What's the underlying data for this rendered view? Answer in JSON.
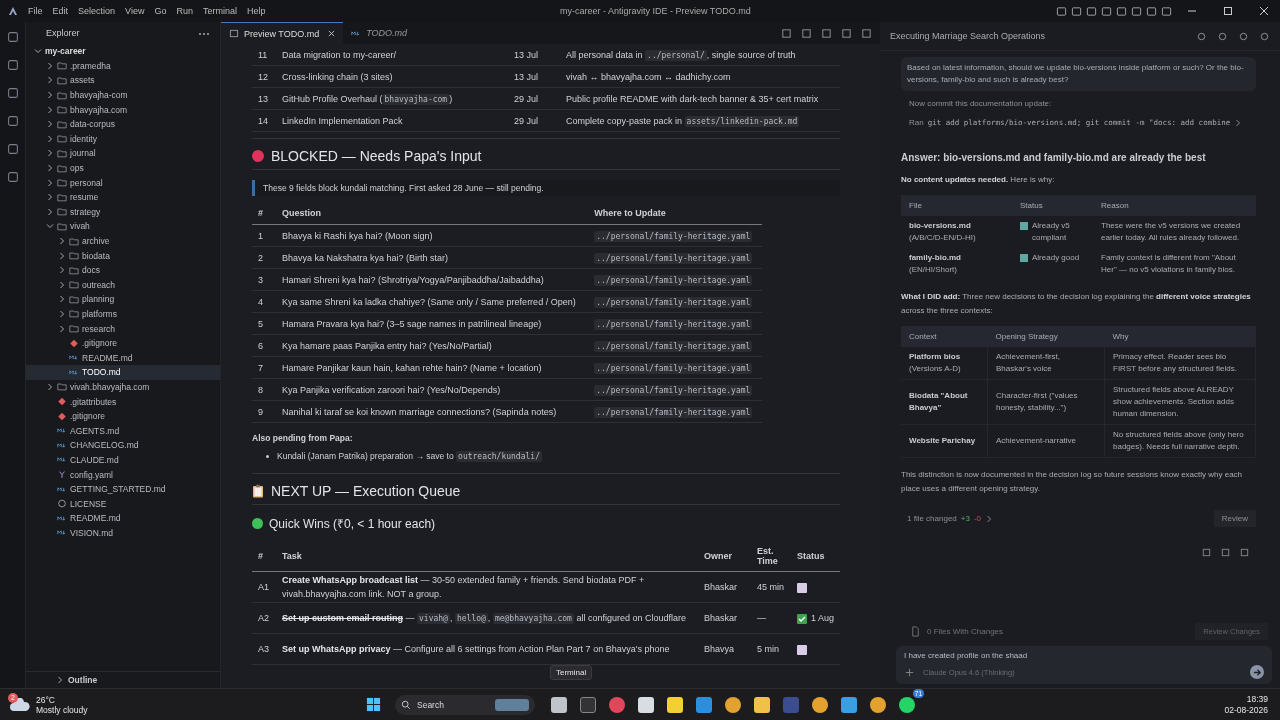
{
  "titlebar": {
    "menus": [
      "File",
      "Edit",
      "Selection",
      "View",
      "Go",
      "Run",
      "Terminal",
      "Help"
    ],
    "title": "my-career - Antigravity IDE - Preview TODO.md"
  },
  "sidebar": {
    "title": "Explorer",
    "outline": "Outline",
    "tree": [
      {
        "label": "my-career",
        "kind": "folder",
        "expanded": true,
        "selected": false,
        "children": [
          {
            "label": ".pramedha",
            "kind": "folder",
            "expanded": false,
            "selected": false
          },
          {
            "label": "assets",
            "kind": "folder",
            "expanded": false,
            "selected": false
          },
          {
            "label": "bhavyajha-com",
            "kind": "folder",
            "expanded": false,
            "selected": false
          },
          {
            "label": "bhavyajha.com",
            "kind": "folder",
            "expanded": false,
            "selected": false
          },
          {
            "label": "data-corpus",
            "kind": "folder",
            "expanded": false,
            "selected": false
          },
          {
            "label": "identity",
            "kind": "folder",
            "expanded": false,
            "selected": false
          },
          {
            "label": "journal",
            "kind": "folder",
            "expanded": false,
            "selected": false
          },
          {
            "label": "ops",
            "kind": "folder",
            "expanded": false,
            "selected": false
          },
          {
            "label": "personal",
            "kind": "folder",
            "expanded": false,
            "selected": false
          },
          {
            "label": "resume",
            "kind": "folder",
            "expanded": false,
            "selected": false
          },
          {
            "label": "strategy",
            "kind": "folder",
            "expanded": false,
            "selected": false
          },
          {
            "label": "vivah",
            "kind": "folder",
            "expanded": true,
            "selected": false,
            "children": [
              {
                "label": "archive",
                "kind": "folder",
                "expanded": false,
                "selected": false
              },
              {
                "label": "biodata",
                "kind": "folder",
                "expanded": false,
                "selected": false
              },
              {
                "label": "docs",
                "kind": "folder",
                "expanded": false,
                "selected": false
              },
              {
                "label": "outreach",
                "kind": "folder",
                "expanded": false,
                "selected": false
              },
              {
                "label": "planning",
                "kind": "folder",
                "expanded": false,
                "selected": false
              },
              {
                "label": "platforms",
                "kind": "folder",
                "expanded": false,
                "selected": false
              },
              {
                "label": "research",
                "kind": "folder",
                "expanded": false,
                "selected": false
              },
              {
                "label": ".gitignore",
                "kind": "git",
                "selected": false
              },
              {
                "label": "README.md",
                "kind": "markdown",
                "selected": false
              },
              {
                "label": "TODO.md",
                "kind": "markdown",
                "selected": true
              }
            ]
          },
          {
            "label": "vivah.bhavyajha.com",
            "kind": "folder",
            "expanded": false,
            "selected": false
          },
          {
            "label": ".gitattributes",
            "kind": "git",
            "selected": false
          },
          {
            "label": ".gitignore",
            "kind": "git",
            "selected": false
          },
          {
            "label": "AGENTS.md",
            "kind": "markdown",
            "selected": false
          },
          {
            "label": "CHANGELOG.md",
            "kind": "markdown",
            "selected": false
          },
          {
            "label": "CLAUDE.md",
            "kind": "markdown",
            "selected": false
          },
          {
            "label": "config.yaml",
            "kind": "yaml",
            "selected": false
          },
          {
            "label": "GETTING_STARTED.md",
            "kind": "markdown",
            "selected": false
          },
          {
            "label": "LICENSE",
            "kind": "license",
            "selected": false
          },
          {
            "label": "README.md",
            "kind": "markdown",
            "selected": false
          },
          {
            "label": "VISION.md",
            "kind": "markdown",
            "selected": false
          }
        ]
      }
    ]
  },
  "tabs": [
    {
      "label": "Preview TODO.md",
      "kind": "preview",
      "selected": true
    },
    {
      "label": "TODO.md",
      "kind": "markdown",
      "selected": false
    }
  ],
  "editor": {
    "done_rows": [
      {
        "num": "11",
        "title": [
          {
            "kind": "text",
            "text": "Data migration to my-career/"
          }
        ],
        "date": "13 Jul",
        "note": [
          {
            "kind": "text",
            "text": "All personal data in "
          },
          {
            "kind": "code",
            "text": "../personal/"
          },
          {
            "kind": "text",
            "text": ", single source of truth"
          }
        ]
      },
      {
        "num": "12",
        "title": [
          {
            "kind": "text",
            "text": "Cross-linking chain (3 sites)"
          }
        ],
        "date": "13 Jul",
        "note": [
          {
            "kind": "text",
            "text": "vivah ↔ bhavyajha.com ↔ dadhichy.com"
          }
        ]
      },
      {
        "num": "13",
        "title": [
          {
            "kind": "text",
            "text": "GitHub Profile Overhaul ("
          },
          {
            "kind": "code",
            "text": "bhavyajha-com"
          },
          {
            "kind": "text",
            "text": ")"
          }
        ],
        "date": "29 Jul",
        "note": [
          {
            "kind": "text",
            "text": "Public profile README with dark-tech banner & 35+ cert matrix"
          }
        ]
      },
      {
        "num": "14",
        "title": [
          {
            "kind": "text",
            "text": "LinkedIn Implementation Pack"
          }
        ],
        "date": "29 Jul",
        "note": [
          {
            "kind": "text",
            "text": "Complete copy-paste pack in "
          },
          {
            "kind": "code",
            "text": "assets/linkedin-pack.md"
          }
        ]
      }
    ],
    "blocked": {
      "heading": "BLOCKED — Needs Papa's Input",
      "note": "These 9 fields block kundali matching. First asked 28 June — still pending.",
      "columns": [
        "#",
        "Question",
        "Where to Update"
      ],
      "rows": [
        {
          "num": "1",
          "question": "Bhavya ki Rashi kya hai? (Moon sign)",
          "where": "../personal/family-heritage.yaml"
        },
        {
          "num": "2",
          "question": "Bhavya ka Nakshatra kya hai? (Birth star)",
          "where": "../personal/family-heritage.yaml"
        },
        {
          "num": "3",
          "question": "Hamari Shreni kya hai? (Shrotriya/Yogya/Panjibaddha/Jaibaddha)",
          "where": "../personal/family-heritage.yaml"
        },
        {
          "num": "4",
          "question": "Kya same Shreni ka ladka chahiye? (Same only / Same preferred / Open)",
          "where": "../personal/family-heritage.yaml"
        },
        {
          "num": "5",
          "question": "Hamara Pravara kya hai? (3–5 sage names in patrilineal lineage)",
          "where": "../personal/family-heritage.yaml"
        },
        {
          "num": "6",
          "question": "Kya hamare paas Panjika entry hai? (Yes/No/Partial)",
          "where": "../personal/family-heritage.yaml"
        },
        {
          "num": "7",
          "question": "Hamare Panjikar kaun hain, kahan rehte hain? (Name + location)",
          "where": "../personal/family-heritage.yaml"
        },
        {
          "num": "8",
          "question": "Kya Panjika verification zaroori hai? (Yes/No/Depends)",
          "where": "../personal/family-heritage.yaml"
        },
        {
          "num": "9",
          "question": "Nanihal ki taraf se koi known marriage connections? (Sapinda notes)",
          "where": "../personal/family-heritage.yaml"
        }
      ],
      "also_title": "Also pending from Papa:",
      "also_items": [
        {
          "text": "Kundali (Janam Patrika) preparation → save to ",
          "code": "outreach/kundali/"
        }
      ]
    },
    "next_heading": "NEXT UP — Execution Queue",
    "quick_heading": "Quick Wins (₹0, < 1 hour each)",
    "tasks": {
      "columns": [
        "#",
        "Task",
        "Owner",
        "Est. Time",
        "Status"
      ],
      "rows": [
        {
          "id": "A1",
          "segments": [
            {
              "kind": "bold",
              "text": "Create WhatsApp broadcast list"
            },
            {
              "kind": "text",
              "text": " — 30-50 extended family + friends. Send biodata PDF + vivah.bhavyajha.com link. NOT a group."
            }
          ],
          "owner": "Bhaskar",
          "time": "45 min",
          "done": false
        },
        {
          "id": "A2",
          "segments": [
            {
              "kind": "bold",
              "text": "Set up custom email routing"
            },
            {
              "kind": "text",
              "text": " — "
            },
            {
              "kind": "code",
              "text": "vivah@"
            },
            {
              "kind": "text",
              "text": ", "
            },
            {
              "kind": "code",
              "text": "hello@"
            },
            {
              "kind": "text",
              "text": ", "
            },
            {
              "kind": "code",
              "text": "me@bhavyajha.com"
            },
            {
              "kind": "text",
              "text": " all configured on Cloudflare"
            }
          ],
          "owner": "Bhaskar",
          "time": "—",
          "done": true,
          "status_text": "1 Aug"
        },
        {
          "id": "A3",
          "segments": [
            {
              "kind": "bold",
              "text": "Set up WhatsApp privacy"
            },
            {
              "kind": "text",
              "text": " — Configure all 6 settings from Action Plan Part 7 on Bhavya's phone"
            }
          ],
          "owner": "Bhavya",
          "time": "5 min",
          "done": false
        }
      ]
    }
  },
  "chat": {
    "title": "Executing Marriage Search Operations",
    "user_message": "Based on latest information, should we update bio-versions inside platform or such? Or the bio-versions, family-bio and such is already best?",
    "step": "Now commit this documentation update:",
    "ran_label": "Ran",
    "ran_command": "git add platforms/bio-versions.md; git commit -m \"docs: add combine",
    "answer_heading": "Answer: bio-versions.md and family-bio.md are already the best",
    "intro": "**No content updates needed.** Here is why:",
    "files_table": {
      "columns": [
        "File",
        "Status",
        "Reason"
      ],
      "rows": [
        {
          "file": "bio-versions.md",
          "detail": "(A/B/C/D-EN/D-HI)",
          "status": "Already v5 compliant",
          "reason": "These were the v5 versions we created earlier today. All rules already followed."
        },
        {
          "file": "family-bio.md",
          "detail": "(EN/HI/Short)",
          "status": "Already good",
          "reason": "Family context is different from \"About Her\" — no v5 violations in family bios."
        }
      ]
    },
    "added": "**What I DID add:** Three new decisions to the decision log explaining the **different voice strategies** across the three contexts:",
    "context_table": {
      "columns": [
        "Context",
        "Opening Strategy",
        "Why"
      ],
      "rows": [
        {
          "context": "Platform bios",
          "detail": "(Versions A-D)",
          "strategy": "Achievement-first, Bhaskar's voice",
          "why": "Primacy effect. Reader sees bio FIRST before any structured fields."
        },
        {
          "context": "Biodata \"About Bhavya\"",
          "strategy": "Character-first (\"values honesty, stability...\")",
          "why": "Structured fields above ALREADY show achievements. Section adds human dimension."
        },
        {
          "context": "Website Parichay",
          "strategy": "Achievement-narrative",
          "why": "No structured fields above (only hero badges). Needs full narrative depth."
        }
      ]
    },
    "closing": "This distinction is now documented in the decision log so future sessions know exactly why each place uses a different opening strategy.",
    "changed": "1 file changed",
    "added_lines": "+3",
    "removed_lines": "-0",
    "review": "Review",
    "files_with_changes": "0 Files With Changes",
    "review_changes": "Review Changes",
    "input_value": "I have created profile on the shaad",
    "model": "Claude Opus 4.6 (Thinking)"
  },
  "taskbar": {
    "weather_badge": "2",
    "temperature": "26°C",
    "weather": "Mostly cloudy",
    "search": "Search",
    "tooltip": "Terminal",
    "whatsapp_badge": "71",
    "time": "18:39",
    "date": "02-08-2026"
  }
}
